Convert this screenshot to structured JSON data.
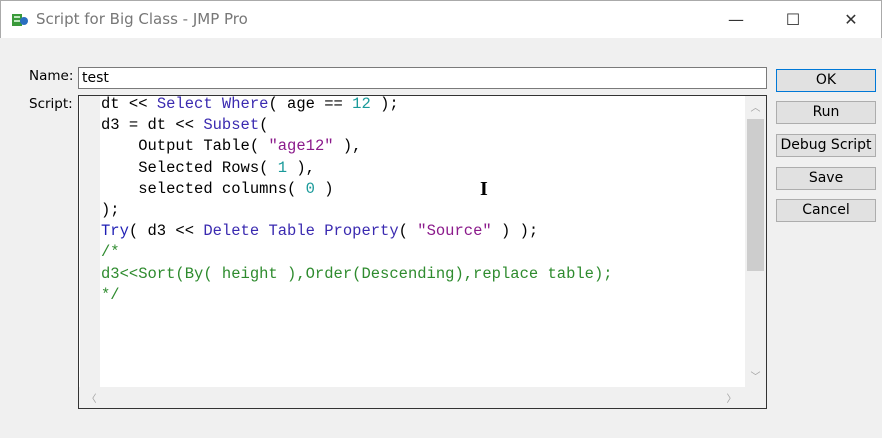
{
  "window": {
    "title": "Script for Big Class - JMP Pro",
    "minimize": "—",
    "maximize": "☐",
    "close": "✕"
  },
  "form": {
    "name_label": "Name:",
    "name_value": "test",
    "script_label": "Script:"
  },
  "buttons": {
    "ok": "OK",
    "run": "Run",
    "debug": "Debug Script",
    "save": "Save",
    "cancel": "Cancel"
  },
  "code_lines": [
    [
      [
        "dt << ",
        ""
      ],
      [
        "Select Where",
        "kw"
      ],
      [
        "( age == ",
        ""
      ],
      [
        "12",
        "num"
      ],
      [
        " );",
        ""
      ]
    ],
    [
      [
        "d3 = dt << ",
        ""
      ],
      [
        "Subset",
        "kw"
      ],
      [
        "(",
        ""
      ]
    ],
    [
      [
        "    Output Table( ",
        ""
      ],
      [
        "\"age12\"",
        "str"
      ],
      [
        " ),",
        ""
      ]
    ],
    [
      [
        "    Selected Rows( ",
        ""
      ],
      [
        "1",
        "num"
      ],
      [
        " ),",
        ""
      ]
    ],
    [
      [
        "    selected columns( ",
        ""
      ],
      [
        "0",
        "num"
      ],
      [
        " )",
        ""
      ]
    ],
    [
      [
        ");",
        ""
      ]
    ],
    [
      [
        "Try",
        "try"
      ],
      [
        "( d3 << ",
        ""
      ],
      [
        "Delete Table Property",
        "kw"
      ],
      [
        "( ",
        ""
      ],
      [
        "\"Source\"",
        "str"
      ],
      [
        " ) );",
        ""
      ]
    ],
    [
      [
        "/*",
        "cm"
      ]
    ],
    [
      [
        "d3<<Sort(By( height ),Order(Descending),replace table);",
        "cm"
      ]
    ],
    [
      [
        "*/",
        "cm"
      ]
    ]
  ]
}
